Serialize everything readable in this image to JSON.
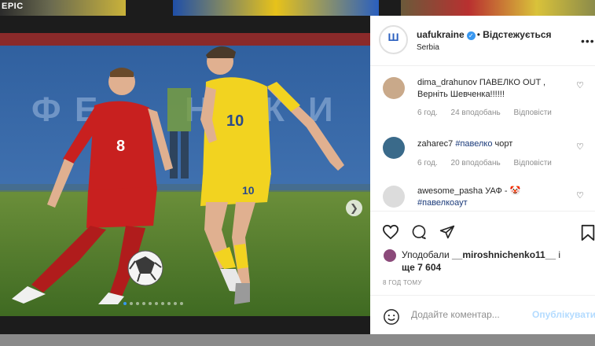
{
  "background": {
    "thumb_text": "EPIC"
  },
  "post": {
    "username": "uafukraine",
    "verified": true,
    "separator": "•",
    "follow_state": "Відстежується",
    "location": "Serbia",
    "more_icon": "more-icon",
    "carousel": {
      "total_slides": 10,
      "active_slide": 1
    }
  },
  "comments": [
    {
      "user": "dima_drahunov",
      "text": "ПАВЕЛКО OUT , Верніть Шевченка!!!!!!",
      "time": "6 год.",
      "likes": "24 вподобань",
      "reply": "Відповісти",
      "avatar_color": "#c9a98a"
    },
    {
      "user": "zaharec7",
      "tag": "#павелко",
      "text": "чорт",
      "time": "6 год.",
      "likes": "20 вподобань",
      "reply": "Відповісти",
      "avatar_color": "#3a6a8a"
    },
    {
      "user": "awesome_pasha",
      "text": "УАФ - 🤡",
      "tag": "#павелкоаут",
      "avatar_color": "#dcdcdc"
    }
  ],
  "actions": {
    "likes_prefix": "Уподобали",
    "likes_user": "__miroshnichenko11__",
    "likes_connector": "і",
    "likes_more": "ще 7 604",
    "time_ago": "8 ГОД ТОМУ"
  },
  "comment_box": {
    "placeholder": "Додайте коментар...",
    "post_label": "Опублікувати"
  },
  "colors": {
    "accent": "#3897f0",
    "post_button_disabled": "#b3dbff",
    "hashtag": "#1a3a7a"
  }
}
